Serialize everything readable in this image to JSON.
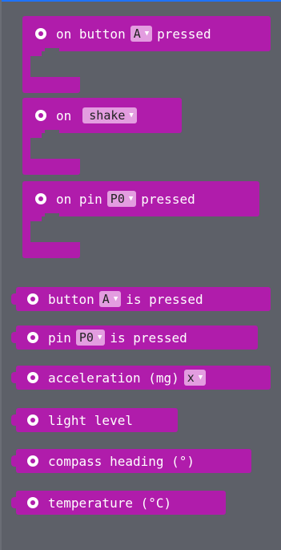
{
  "blocks": {
    "on_button": {
      "prefix": "on button",
      "option": "A",
      "suffix": "pressed"
    },
    "on_shake": {
      "prefix": "on",
      "option": "shake"
    },
    "on_pin": {
      "prefix": "on pin",
      "option": "P0",
      "suffix": "pressed"
    },
    "button_pressed": {
      "prefix": "button",
      "option": "A",
      "suffix": "is pressed"
    },
    "pin_pressed": {
      "prefix": "pin",
      "option": "P0",
      "suffix": "is pressed"
    },
    "acceleration": {
      "prefix": "acceleration (mg)",
      "option": "x"
    },
    "light_level": {
      "label": "light level"
    },
    "compass_heading": {
      "label": "compass heading (°)"
    },
    "temperature": {
      "label": "temperature (°C)"
    }
  },
  "icons": {
    "block_icon": "gear-dot-icon",
    "dropdown_icon": "dropdown-arrow-icon"
  },
  "colors": {
    "block": "#b01cab",
    "dropdown": "#e39de0",
    "background": "#5d6068"
  }
}
